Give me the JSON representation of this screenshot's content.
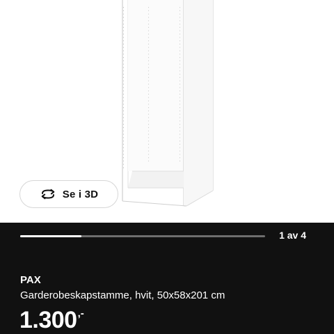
{
  "view_3d": {
    "label": "Se i 3D",
    "icon": "rotate-3d-icon"
  },
  "carousel": {
    "counter": "1 av 4",
    "current": 1,
    "total": 4
  },
  "product": {
    "name": "PAX",
    "description": "Garderobeskapstamme, hvit, 50x58x201 cm",
    "price": "1.300",
    "price_suffix": ",-"
  },
  "colors": {
    "panel_background": "#111111",
    "text": "#ffffff",
    "progress_track": "#6e6e6e",
    "progress_fill": "#ffffff"
  }
}
